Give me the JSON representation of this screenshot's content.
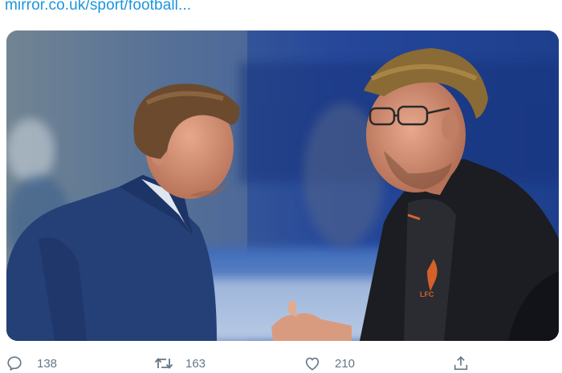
{
  "tweet": {
    "link_text": "mirror.co.uk/sport/football...",
    "media": {
      "kind": "photo",
      "badge_text": "LFC"
    },
    "actions": {
      "reply": {
        "icon": "reply-icon",
        "count": "138"
      },
      "retweet": {
        "icon": "retweet-icon",
        "count": "163"
      },
      "like": {
        "icon": "heart-icon",
        "count": "210"
      },
      "share": {
        "icon": "share-icon"
      }
    }
  },
  "colors": {
    "link": "#1b95e0",
    "action_gray": "#657786"
  }
}
